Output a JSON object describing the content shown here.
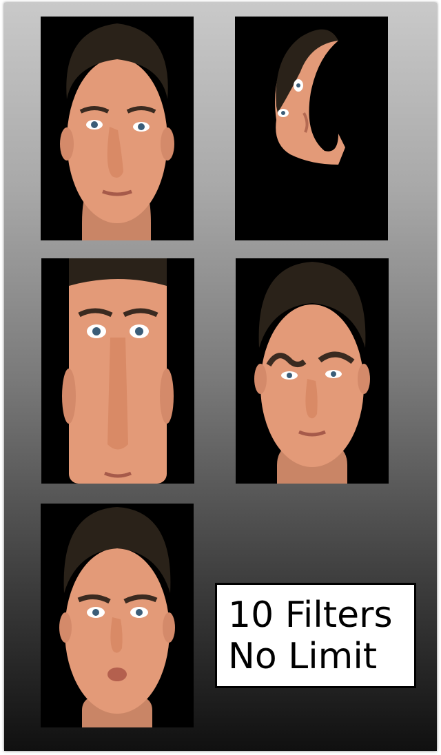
{
  "gallery": {
    "tiles": [
      {
        "id": "face-1",
        "filter": "face-distortion"
      },
      {
        "id": "face-2",
        "filter": "face-twist"
      },
      {
        "id": "face-3",
        "filter": "face-stretch"
      },
      {
        "id": "face-4",
        "filter": "face-brow-warp"
      },
      {
        "id": "face-5",
        "filter": "face-squish"
      }
    ]
  },
  "promo": {
    "line1": "10 Filters",
    "line2": "No Limit"
  },
  "colors": {
    "skin": "#e39a78",
    "hair": "#2a2219",
    "background": "#000000"
  }
}
